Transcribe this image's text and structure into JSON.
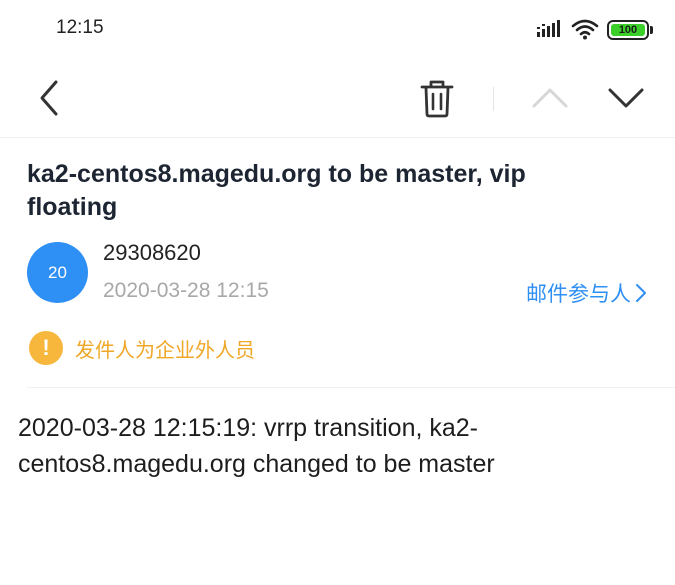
{
  "status_bar": {
    "time": "12:15",
    "battery_level": "100",
    "icons": [
      "signal-icon",
      "wifi-icon",
      "battery-icon"
    ]
  },
  "toolbar": {
    "icons": [
      "back-icon",
      "trash-icon",
      "chevron-up-icon",
      "chevron-down-icon"
    ],
    "prev_enabled": false,
    "next_enabled": true
  },
  "email": {
    "subject": "ka2-centos8.magedu.org to be master, vip floating",
    "avatar_text": "20",
    "sender": "29308620",
    "sent_time": "2020-03-28 12:15",
    "participants_label": "邮件参与人",
    "external_warning": "发件人为企业外人员",
    "body": "2020-03-28 12:15:19: vrrp transition, ka2-centos8.magedu.org changed to be master"
  },
  "colors": {
    "accent": "#2e8ff5",
    "warning": "#f6b73c",
    "battery_fill": "#3ccf2a",
    "secondary_text": "#a8a8a8"
  }
}
